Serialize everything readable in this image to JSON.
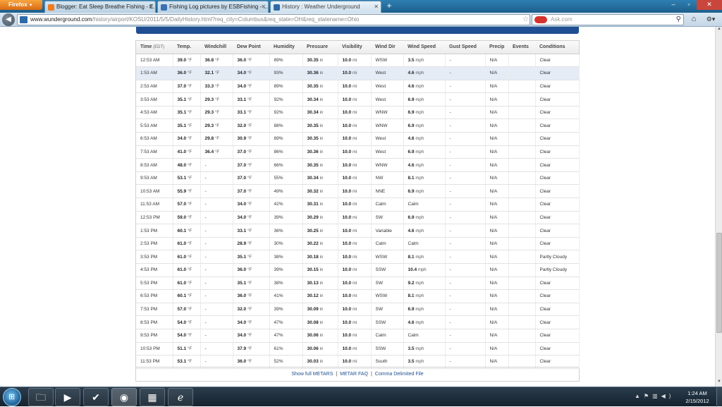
{
  "browser": {
    "menu_label": "Firefox",
    "tabs": [
      {
        "label": "Blogger: Eat Sleep Breathe Fishing - E...",
        "color": "#f07b20"
      },
      {
        "label": "Fishing Log pictures by ESBFishing - ...",
        "color": "#3b6fb6"
      },
      {
        "label": "History : Weather Underground",
        "color": "#2d6aa8"
      }
    ],
    "url_host": "www.wunderground.com",
    "url_path": "/history/airport/KOSU/2011/5/5/DailyHistory.html?req_city=Columbus&req_state=OH&req_statename=Ohio",
    "search_placeholder": "Ask.com"
  },
  "table": {
    "headers": {
      "time": "Time",
      "time_unit": "(EDT)",
      "temp": "Temp.",
      "windchill": "Windchill",
      "dewpoint": "Dew Point",
      "humidity": "Humidity",
      "pressure": "Pressure",
      "visibility": "Visibility",
      "wind_dir": "Wind Dir",
      "wind_speed": "Wind Speed",
      "gust_speed": "Gust Speed",
      "precip": "Precip",
      "events": "Events",
      "conditions": "Conditions"
    },
    "rows": [
      {
        "time": "12:53 AM",
        "temp": "39.0",
        "windchill": "36.8",
        "dew": "36.0",
        "hum": "89%",
        "press": "30.35",
        "vis": "10.0",
        "dir": "WSW",
        "speed": "3.5",
        "gust": "-",
        "precip": "N/A",
        "events": "",
        "cond": "Clear"
      },
      {
        "time": "1:53 AM",
        "temp": "36.0",
        "windchill": "32.1",
        "dew": "34.0",
        "hum": "93%",
        "press": "30.36",
        "vis": "10.0",
        "dir": "West",
        "speed": "4.6",
        "gust": "-",
        "precip": "N/A",
        "events": "",
        "cond": "Clear"
      },
      {
        "time": "2:53 AM",
        "temp": "37.0",
        "windchill": "33.3",
        "dew": "34.0",
        "hum": "89%",
        "press": "30.35",
        "vis": "10.0",
        "dir": "West",
        "speed": "4.6",
        "gust": "-",
        "precip": "N/A",
        "events": "",
        "cond": "Clear"
      },
      {
        "time": "3:53 AM",
        "temp": "35.1",
        "windchill": "29.3",
        "dew": "33.1",
        "hum": "92%",
        "press": "30.34",
        "vis": "10.0",
        "dir": "West",
        "speed": "6.9",
        "gust": "-",
        "precip": "N/A",
        "events": "",
        "cond": "Clear"
      },
      {
        "time": "4:53 AM",
        "temp": "35.1",
        "windchill": "29.3",
        "dew": "33.1",
        "hum": "92%",
        "press": "30.34",
        "vis": "10.0",
        "dir": "WNW",
        "speed": "6.9",
        "gust": "-",
        "precip": "N/A",
        "events": "",
        "cond": "Clear"
      },
      {
        "time": "5:53 AM",
        "temp": "35.1",
        "windchill": "29.3",
        "dew": "32.0",
        "hum": "88%",
        "press": "30.35",
        "vis": "10.0",
        "dir": "WNW",
        "speed": "6.9",
        "gust": "-",
        "precip": "N/A",
        "events": "",
        "cond": "Clear"
      },
      {
        "time": "6:53 AM",
        "temp": "34.0",
        "windchill": "29.8",
        "dew": "30.9",
        "hum": "89%",
        "press": "30.35",
        "vis": "10.0",
        "dir": "West",
        "speed": "4.6",
        "gust": "-",
        "precip": "N/A",
        "events": "",
        "cond": "Clear"
      },
      {
        "time": "7:53 AM",
        "temp": "41.0",
        "windchill": "36.4",
        "dew": "37.0",
        "hum": "86%",
        "press": "30.36",
        "vis": "10.0",
        "dir": "West",
        "speed": "6.9",
        "gust": "-",
        "precip": "N/A",
        "events": "",
        "cond": "Clear"
      },
      {
        "time": "8:53 AM",
        "temp": "48.0",
        "windchill": "-",
        "dew": "37.0",
        "hum": "66%",
        "press": "30.35",
        "vis": "10.0",
        "dir": "WNW",
        "speed": "4.6",
        "gust": "-",
        "precip": "N/A",
        "events": "",
        "cond": "Clear"
      },
      {
        "time": "9:53 AM",
        "temp": "53.1",
        "windchill": "-",
        "dew": "37.0",
        "hum": "55%",
        "press": "30.34",
        "vis": "10.0",
        "dir": "NW",
        "speed": "8.1",
        "gust": "-",
        "precip": "N/A",
        "events": "",
        "cond": "Clear"
      },
      {
        "time": "10:53 AM",
        "temp": "55.9",
        "windchill": "-",
        "dew": "37.0",
        "hum": "49%",
        "press": "30.32",
        "vis": "10.0",
        "dir": "NNE",
        "speed": "6.9",
        "gust": "-",
        "precip": "N/A",
        "events": "",
        "cond": "Clear"
      },
      {
        "time": "11:53 AM",
        "temp": "57.0",
        "windchill": "-",
        "dew": "34.0",
        "hum": "42%",
        "press": "30.31",
        "vis": "10.0",
        "dir": "Calm",
        "speed": "Calm",
        "gust": "-",
        "precip": "N/A",
        "events": "",
        "cond": "Clear"
      },
      {
        "time": "12:53 PM",
        "temp": "59.0",
        "windchill": "-",
        "dew": "34.0",
        "hum": "39%",
        "press": "30.29",
        "vis": "10.0",
        "dir": "SW",
        "speed": "6.9",
        "gust": "-",
        "precip": "N/A",
        "events": "",
        "cond": "Clear"
      },
      {
        "time": "1:53 PM",
        "temp": "60.1",
        "windchill": "-",
        "dew": "33.1",
        "hum": "36%",
        "press": "30.25",
        "vis": "10.0",
        "dir": "Variable",
        "speed": "4.6",
        "gust": "-",
        "precip": "N/A",
        "events": "",
        "cond": "Clear"
      },
      {
        "time": "2:53 PM",
        "temp": "61.0",
        "windchill": "-",
        "dew": "28.9",
        "hum": "30%",
        "press": "30.22",
        "vis": "10.0",
        "dir": "Calm",
        "speed": "Calm",
        "gust": "-",
        "precip": "N/A",
        "events": "",
        "cond": "Clear"
      },
      {
        "time": "3:53 PM",
        "temp": "61.0",
        "windchill": "-",
        "dew": "35.1",
        "hum": "38%",
        "press": "30.18",
        "vis": "10.0",
        "dir": "WSW",
        "speed": "8.1",
        "gust": "-",
        "precip": "N/A",
        "events": "",
        "cond": "Partly Cloudy"
      },
      {
        "time": "4:53 PM",
        "temp": "61.0",
        "windchill": "-",
        "dew": "36.0",
        "hum": "39%",
        "press": "30.15",
        "vis": "10.0",
        "dir": "SSW",
        "speed": "10.4",
        "gust": "-",
        "precip": "N/A",
        "events": "",
        "cond": "Partly Cloudy"
      },
      {
        "time": "5:53 PM",
        "temp": "61.0",
        "windchill": "-",
        "dew": "35.1",
        "hum": "38%",
        "press": "30.13",
        "vis": "10.0",
        "dir": "SW",
        "speed": "9.2",
        "gust": "-",
        "precip": "N/A",
        "events": "",
        "cond": "Clear"
      },
      {
        "time": "6:53 PM",
        "temp": "60.1",
        "windchill": "-",
        "dew": "36.0",
        "hum": "41%",
        "press": "30.12",
        "vis": "10.0",
        "dir": "WSW",
        "speed": "8.1",
        "gust": "-",
        "precip": "N/A",
        "events": "",
        "cond": "Clear"
      },
      {
        "time": "7:53 PM",
        "temp": "57.0",
        "windchill": "-",
        "dew": "32.0",
        "hum": "39%",
        "press": "30.09",
        "vis": "10.0",
        "dir": "SW",
        "speed": "6.9",
        "gust": "-",
        "precip": "N/A",
        "events": "",
        "cond": "Clear"
      },
      {
        "time": "8:53 PM",
        "temp": "54.0",
        "windchill": "-",
        "dew": "34.0",
        "hum": "47%",
        "press": "30.08",
        "vis": "10.0",
        "dir": "SSW",
        "speed": "4.6",
        "gust": "-",
        "precip": "N/A",
        "events": "",
        "cond": "Clear"
      },
      {
        "time": "9:53 PM",
        "temp": "54.0",
        "windchill": "-",
        "dew": "34.0",
        "hum": "47%",
        "press": "30.06",
        "vis": "10.0",
        "dir": "Calm",
        "speed": "Calm",
        "gust": "-",
        "precip": "N/A",
        "events": "",
        "cond": "Clear"
      },
      {
        "time": "10:53 PM",
        "temp": "51.1",
        "windchill": "-",
        "dew": "37.9",
        "hum": "61%",
        "press": "30.06",
        "vis": "10.0",
        "dir": "SSW",
        "speed": "3.5",
        "gust": "-",
        "precip": "N/A",
        "events": "",
        "cond": "Clear"
      },
      {
        "time": "11:53 PM",
        "temp": "53.1",
        "windchill": "-",
        "dew": "36.0",
        "hum": "52%",
        "press": "30.03",
        "vis": "10.0",
        "dir": "South",
        "speed": "3.5",
        "gust": "-",
        "precip": "N/A",
        "events": "",
        "cond": "Clear"
      }
    ],
    "units": {
      "temp": "°F",
      "pressure": "in",
      "visibility": "mi",
      "speed": "mph"
    }
  },
  "footer": {
    "show_label": "Show",
    "metars_link": "full METARS",
    "faq_link": "METAR FAQ",
    "csv_link": "Comma Delimited File",
    "separator": "|"
  },
  "taskbar": {
    "time": "1:24 AM",
    "date": "2/15/2012",
    "pinned": [
      "file-explorer",
      "media-player",
      "tasks",
      "firefox",
      "calculator",
      "internet-explorer"
    ]
  },
  "colors": {
    "brand_blue": "#1f4f92",
    "highlight_row": "#e6ecf6"
  }
}
